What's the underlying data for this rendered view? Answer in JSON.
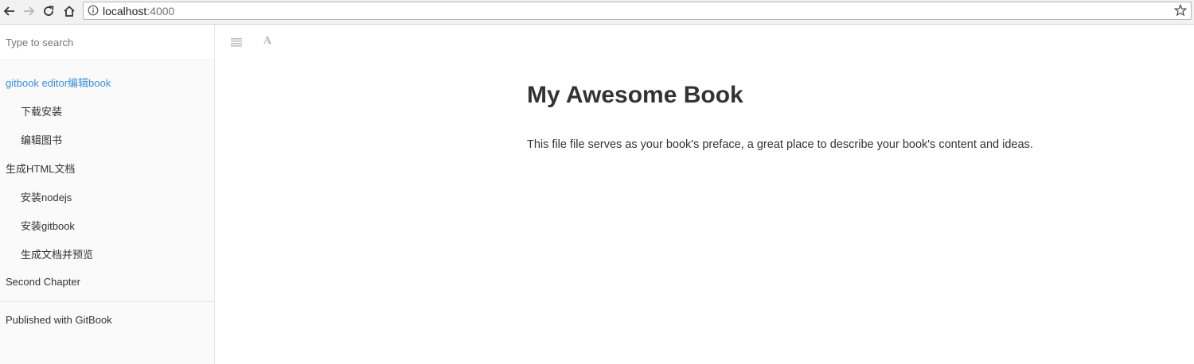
{
  "browser": {
    "url_host": "localhost",
    "url_port": ":4000",
    "icons": [
      "back-icon",
      "forward-icon",
      "reload-icon",
      "home-icon",
      "info-icon",
      "star-icon"
    ]
  },
  "sidebar": {
    "search_placeholder": "Type to search",
    "items": [
      {
        "label": "gitbook editor编辑book",
        "level": 1,
        "active": true
      },
      {
        "label": "下载安装",
        "level": 2
      },
      {
        "label": "编辑图书",
        "level": 2
      },
      {
        "label": "生成HTML文档",
        "level": 1
      },
      {
        "label": "安装nodejs",
        "level": 2
      },
      {
        "label": "安装gitbook",
        "level": 2
      },
      {
        "label": "生成文档并预览",
        "level": 2
      },
      {
        "label": "Second Chapter",
        "level": 1
      }
    ],
    "published": "Published with GitBook"
  },
  "toolbar": {
    "menu_icon": "hamburger-menu-icon",
    "font_icon": "font-settings-icon",
    "font_glyph": "A"
  },
  "main": {
    "title": "My Awesome Book",
    "text": "This file file serves as your book's preface, a great place to describe your book's content and ideas."
  },
  "colors": {
    "active_link": "#3b8ee2",
    "sidebar_bg": "#fafafa",
    "text": "#333333"
  }
}
